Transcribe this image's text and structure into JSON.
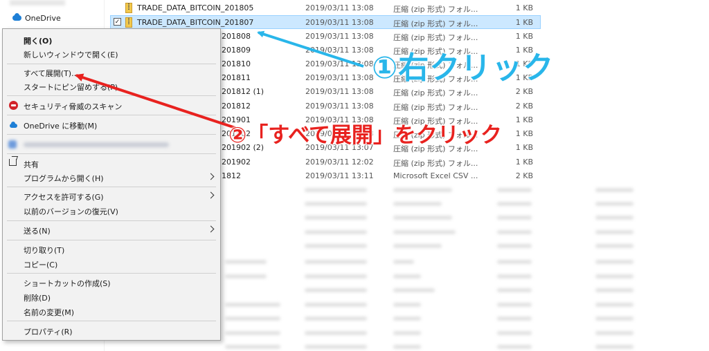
{
  "nav": {
    "onedrive_label": "OneDrive"
  },
  "files": [
    {
      "name": "TRADE_DATA_BITCOIN_201805",
      "date": "2019/03/11 13:08",
      "type": "圧縮 (zip 形式) フォル...",
      "size": "1 KB",
      "icon": "zip-icon",
      "selected": false
    },
    {
      "name": "TRADE_DATA_BITCOIN_201807",
      "date": "2019/03/11 13:08",
      "type": "圧縮 (zip 形式) フォル...",
      "size": "1 KB",
      "icon": "zip-icon",
      "selected": true
    },
    {
      "name": "201808",
      "date": "2019/03/11 13:08",
      "type": "圧縮 (zip 形式) フォル...",
      "size": "1 KB",
      "icon": "zip-icon",
      "selected": false
    },
    {
      "name": "201809",
      "date": "2019/03/11 13:08",
      "type": "圧縮 (zip 形式) フォル...",
      "size": "1 KB",
      "icon": "zip-icon",
      "selected": false
    },
    {
      "name": "201810",
      "date": "2019/03/11 13:08",
      "type": "圧縮 (zip 形式) フォル...",
      "size": "1 KB",
      "icon": "zip-icon",
      "selected": false
    },
    {
      "name": "201811",
      "date": "2019/03/11 13:08",
      "type": "圧縮 (zip 形式) フォル...",
      "size": "1 KB",
      "icon": "zip-icon",
      "selected": false
    },
    {
      "name": "201812 (1)",
      "date": "2019/03/11 13:08",
      "type": "圧縮 (zip 形式) フォル...",
      "size": "2 KB",
      "icon": "zip-icon",
      "selected": false
    },
    {
      "name": "201812",
      "date": "2019/03/11 13:08",
      "type": "圧縮 (zip 形式) フォル...",
      "size": "2 KB",
      "icon": "zip-icon",
      "selected": false
    },
    {
      "name": "201901",
      "date": "2019/03/11 13:08",
      "type": "圧縮 (zip 形式) フォル...",
      "size": "1 KB",
      "icon": "zip-icon",
      "selected": false
    },
    {
      "name": "201902",
      "date": "2019/03/11 13:08",
      "type": "圧縮 (zip 形式) フォル...",
      "size": "1 KB",
      "icon": "zip-icon",
      "selected": false
    },
    {
      "name": "201902 (2)",
      "date": "2019/03/11 13:07",
      "type": "圧縮 (zip 形式) フォル...",
      "size": "1 KB",
      "icon": "zip-icon",
      "selected": false
    },
    {
      "name": "201902",
      "date": "2019/03/11 12:02",
      "type": "圧縮 (zip 形式) フォル...",
      "size": "1 KB",
      "icon": "zip-icon",
      "selected": false
    },
    {
      "name": "1812",
      "date": "2019/03/11 13:11",
      "type": "Microsoft Excel CSV ...",
      "size": "2 KB",
      "icon": "excel-icon",
      "selected": false
    }
  ],
  "context_menu": {
    "open": "開く(O)",
    "open_new_window": "新しいウィンドウで開く(E)",
    "extract_all": "すべて展開(T)...",
    "pin_start": "スタートにピン留めする(P)",
    "security_scan": "セキュリティ脅威のスキャン",
    "onedrive_move": "OneDrive に移動(M)",
    "share": "共有",
    "open_with": "プログラムから開く(H)",
    "give_access": "アクセスを許可する(G)",
    "restore_versions": "以前のバージョンの復元(V)",
    "send_to": "送る(N)",
    "cut": "切り取り(T)",
    "copy": "コピー(C)",
    "create_shortcut": "ショートカットの作成(S)",
    "delete": "削除(D)",
    "rename": "名前の変更(M)",
    "properties": "プロパティ(R)"
  },
  "annotations": {
    "step1": "①右クリック",
    "step2": "②「すべて展開」をクリック"
  },
  "colors": {
    "step1": "#29b6ea",
    "step2": "#e8221f",
    "selection": "#cce8ff"
  }
}
